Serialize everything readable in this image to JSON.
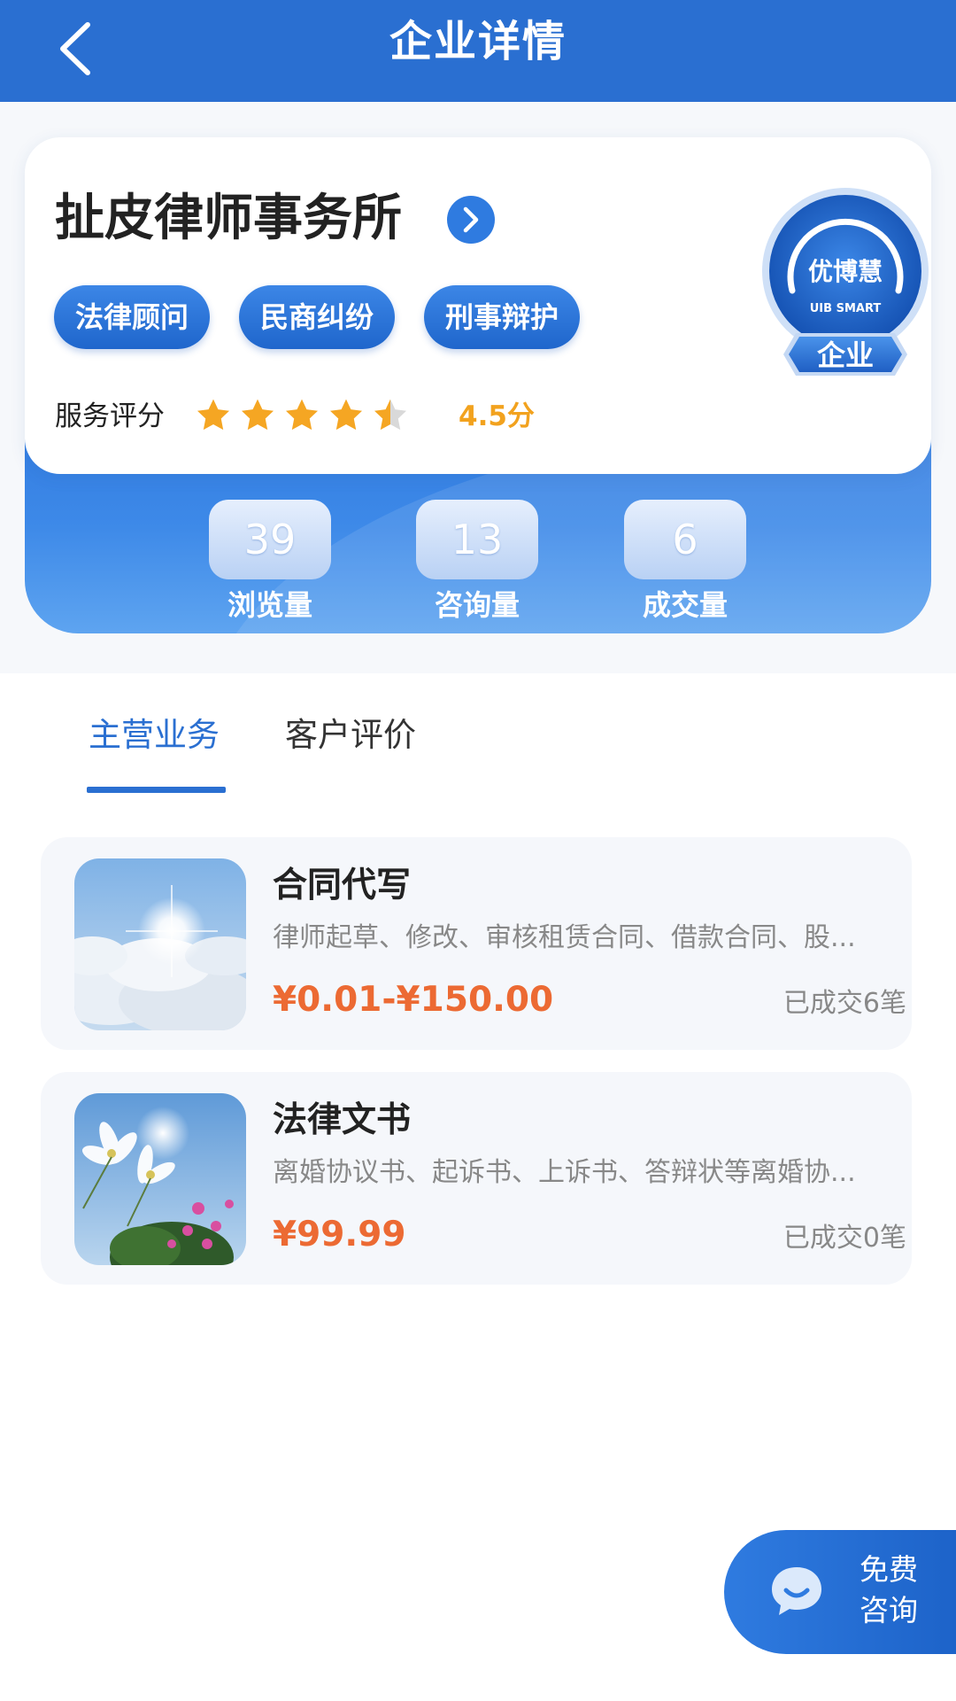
{
  "header": {
    "title": "企业详情"
  },
  "company": {
    "name": "扯皮律师事务所",
    "tags": [
      "法律顾问",
      "民商纠纷",
      "刑事辩护"
    ],
    "rating_label": "服务评分",
    "rating_value": 4.5,
    "rating_text": "4.5分",
    "badge": {
      "brand": "优博慧",
      "sub": "UIB SMART",
      "type": "企业"
    }
  },
  "stats": [
    {
      "value": "39",
      "label": "浏览量"
    },
    {
      "value": "13",
      "label": "咨询量"
    },
    {
      "value": "6",
      "label": "成交量"
    }
  ],
  "tabs": [
    {
      "label": "主营业务",
      "active": true
    },
    {
      "label": "客户评价",
      "active": false
    }
  ],
  "services": [
    {
      "title": "合同代写",
      "desc": "律师起草、修改、审核租赁合同、借款合同、股...",
      "price": "¥0.01-¥150.00",
      "deals": "已成交6笔",
      "image": "sky-clouds-sun"
    },
    {
      "title": "法律文书",
      "desc": "离婚协议书、起诉书、上诉书、答辩状等离婚协...",
      "price": "¥99.99",
      "deals": "已成交0笔",
      "image": "cosmos-flowers-sky"
    }
  ],
  "consult": {
    "line1": "免费",
    "line2": "咨询"
  },
  "colors": {
    "primary": "#2a6fd1",
    "price": "#ec6a33",
    "rating": "#f2a21e"
  }
}
